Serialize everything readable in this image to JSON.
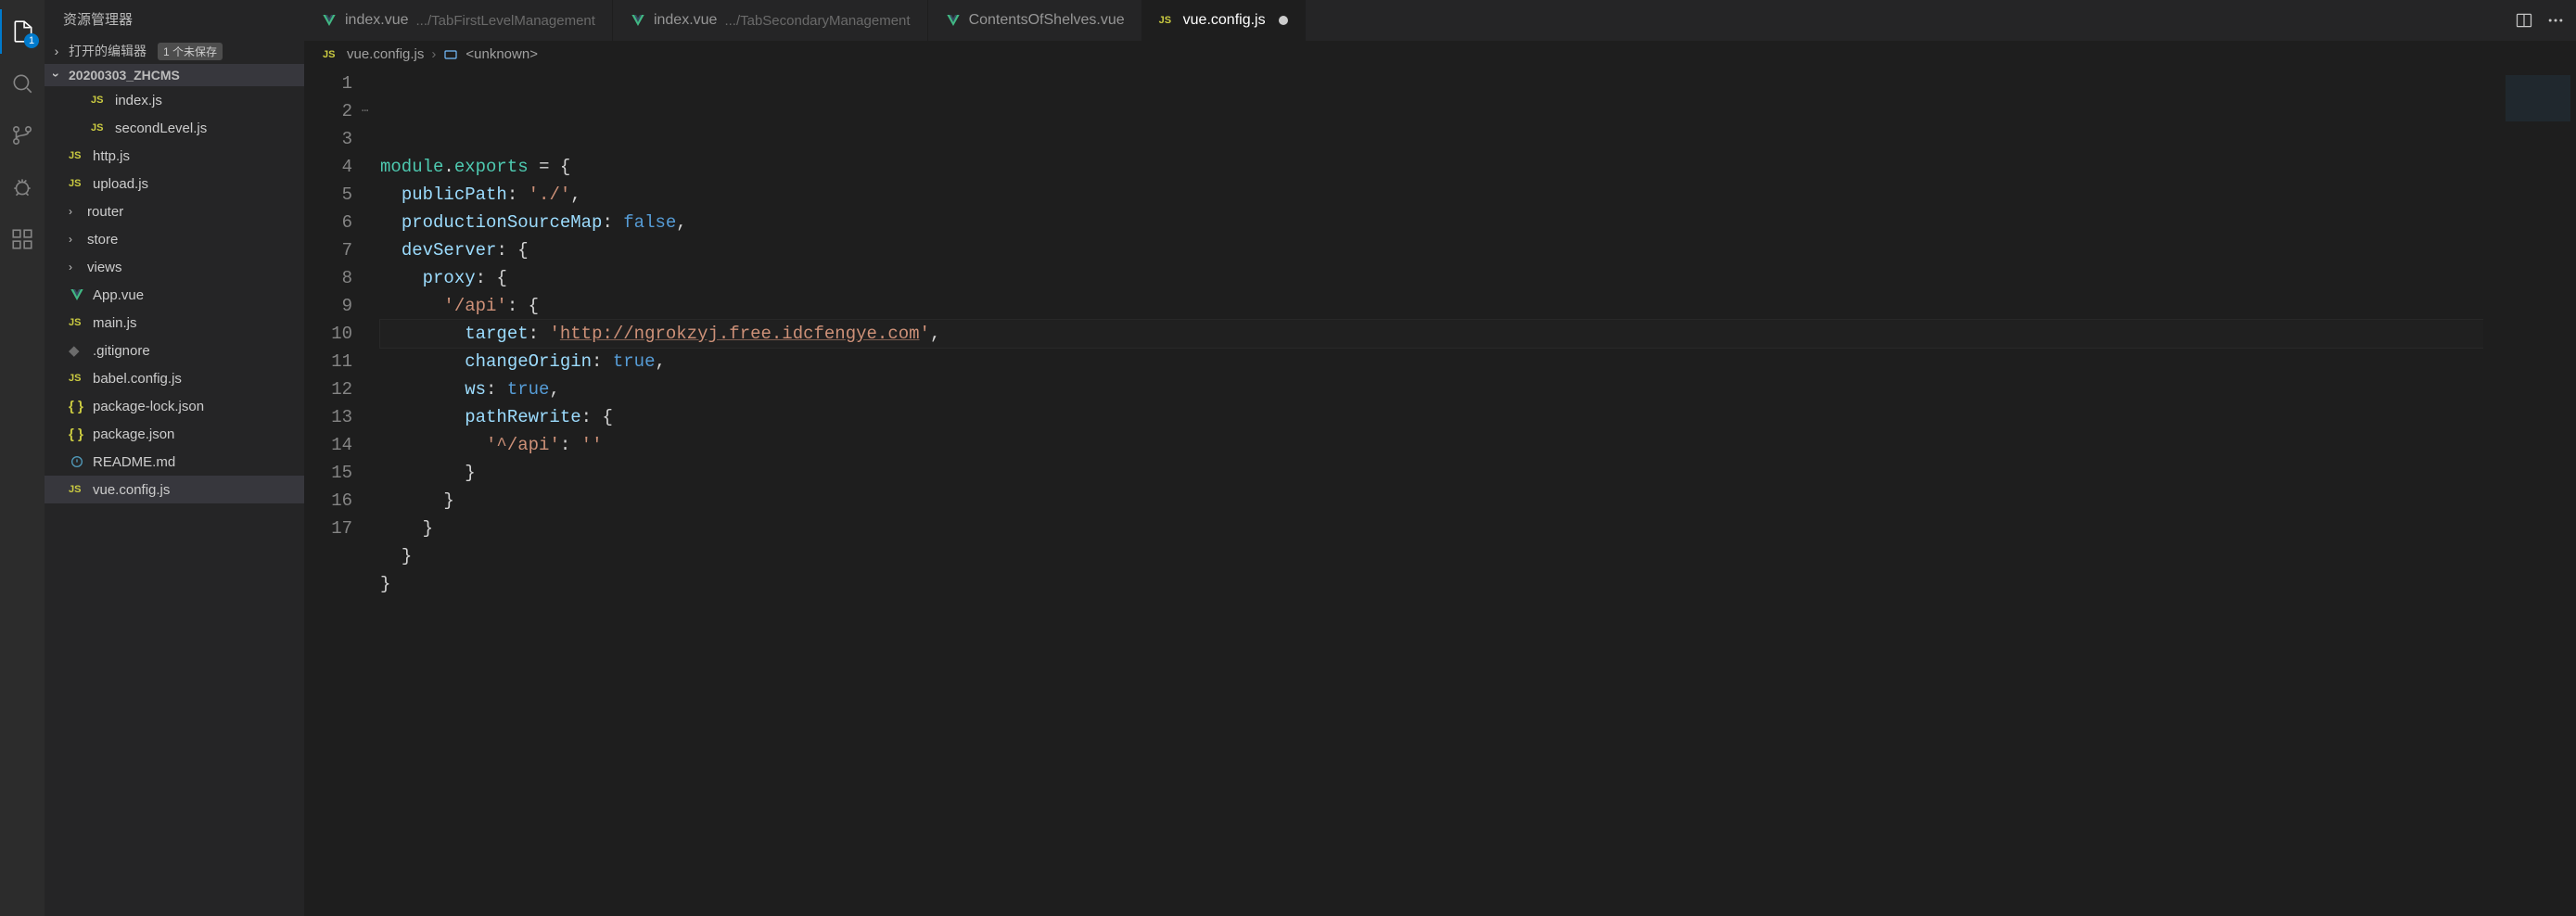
{
  "activityBar": {
    "explorerBadge": "1"
  },
  "sidebar": {
    "title": "资源管理器",
    "openEditors": {
      "label": "打开的编辑器",
      "unsaved": "1 个未保存"
    },
    "project": "20200303_ZHCMS",
    "tree": [
      {
        "kind": "js",
        "label": "index.js",
        "indent": "nested"
      },
      {
        "kind": "js",
        "label": "secondLevel.js",
        "indent": "nested"
      },
      {
        "kind": "js",
        "label": "http.js"
      },
      {
        "kind": "js",
        "label": "upload.js"
      },
      {
        "kind": "folder",
        "label": "router"
      },
      {
        "kind": "folder",
        "label": "store"
      },
      {
        "kind": "folder",
        "label": "views"
      },
      {
        "kind": "vue",
        "label": "App.vue"
      },
      {
        "kind": "js",
        "label": "main.js"
      },
      {
        "kind": "git",
        "label": ".gitignore"
      },
      {
        "kind": "js",
        "label": "babel.config.js"
      },
      {
        "kind": "json",
        "label": "package-lock.json"
      },
      {
        "kind": "json",
        "label": "package.json"
      },
      {
        "kind": "md",
        "label": "README.md"
      },
      {
        "kind": "js",
        "label": "vue.config.js",
        "selected": true
      }
    ]
  },
  "tabs": [
    {
      "icon": "vue",
      "name": "index.vue",
      "hint": ".../TabFirstLevelManagement"
    },
    {
      "icon": "vue",
      "name": "index.vue",
      "hint": ".../TabSecondaryManagement"
    },
    {
      "icon": "vue",
      "name": "ContentsOfShelves.vue",
      "hint": ""
    },
    {
      "icon": "js",
      "name": "vue.config.js",
      "hint": "",
      "active": true,
      "dirty": true
    }
  ],
  "breadcrumb": {
    "file": "vue.config.js",
    "symbol": "<unknown>"
  },
  "code": {
    "lines": [
      {
        "n": 1,
        "html": "<span class='tok-mod'>module</span><span class='tok-punc'>.</span><span class='tok-mod'>exports</span> <span class='tok-punc'>=</span> <span class='tok-punc'>{</span>"
      },
      {
        "n": 2,
        "html": "  <span class='tok-prop'>publicPath</span><span class='tok-punc'>:</span> <span class='tok-str'>'./'</span><span class='tok-punc'>,</span>"
      },
      {
        "n": 3,
        "html": "  <span class='tok-prop'>productionSourceMap</span><span class='tok-punc'>:</span> <span class='tok-kw'>false</span><span class='tok-punc'>,</span>"
      },
      {
        "n": 4,
        "html": "  <span class='tok-prop'>devServer</span><span class='tok-punc'>:</span> <span class='tok-punc'>{</span>"
      },
      {
        "n": 5,
        "html": "    <span class='tok-prop'>proxy</span><span class='tok-punc'>:</span> <span class='tok-punc'>{</span>"
      },
      {
        "n": 6,
        "html": "      <span class='tok-str'>'/api'</span><span class='tok-punc'>:</span> <span class='tok-punc'>{</span>"
      },
      {
        "n": 7,
        "hl": true,
        "html": "        <span class='tok-prop'>target</span><span class='tok-punc'>:</span> <span class='tok-str'>'<span class='tok-link'>http://ngrokzyj.free.idcfengye.com</span>'</span><span class='tok-punc'>,</span>"
      },
      {
        "n": 8,
        "html": "        <span class='tok-prop'>changeOrigin</span><span class='tok-punc'>:</span> <span class='tok-kw'>true</span><span class='tok-punc'>,</span>"
      },
      {
        "n": 9,
        "html": "        <span class='tok-prop'>ws</span><span class='tok-punc'>:</span> <span class='tok-kw'>true</span><span class='tok-punc'>,</span>"
      },
      {
        "n": 10,
        "html": "        <span class='tok-prop'>pathRewrite</span><span class='tok-punc'>:</span> <span class='tok-punc'>{</span>"
      },
      {
        "n": 11,
        "html": "          <span class='tok-str'>'^/api'</span><span class='tok-punc'>:</span> <span class='tok-str'>''</span>"
      },
      {
        "n": 12,
        "html": "        <span class='tok-punc'>}</span>"
      },
      {
        "n": 13,
        "html": "      <span class='tok-punc'>}</span>"
      },
      {
        "n": 14,
        "html": "    <span class='tok-punc'>}</span>"
      },
      {
        "n": 15,
        "html": "  <span class='tok-punc'>}</span>"
      },
      {
        "n": 16,
        "html": "<span class='tok-punc'>}</span>"
      },
      {
        "n": 17,
        "html": ""
      }
    ]
  }
}
